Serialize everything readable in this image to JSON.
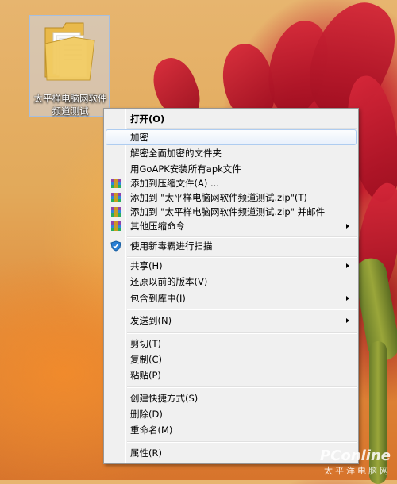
{
  "desktop": {
    "folder_label_line1": "太平样电脑网软件",
    "folder_label_line2": "频道测试"
  },
  "context_menu": {
    "items": [
      {
        "label": "打开(O)",
        "bold": true
      },
      {
        "label": "加密",
        "highlighted": true
      },
      {
        "label": "解密全面加密的文件夹"
      },
      {
        "label": "用GoAPK安装所有apk文件"
      },
      {
        "label": "添加到压缩文件(A) ...",
        "icon": "winrar-icon"
      },
      {
        "label": "添加到 \"太平样电脑网软件频道测试.zip\"(T)",
        "icon": "winrar-icon"
      },
      {
        "label": "添加到 \"太平样电脑网软件频道测试.zip\" 并邮件",
        "icon": "winrar-icon"
      },
      {
        "label": "其他压缩命令",
        "icon": "winrar-icon",
        "submenu": true
      },
      {
        "label": "使用新毒霸进行扫描",
        "icon": "duba-shield-icon"
      },
      {
        "label": "共享(H)",
        "submenu": true
      },
      {
        "label": "还原以前的版本(V)"
      },
      {
        "label": "包含到库中(I)",
        "submenu": true
      },
      {
        "label": "发送到(N)",
        "submenu": true
      },
      {
        "label": "剪切(T)"
      },
      {
        "label": "复制(C)"
      },
      {
        "label": "粘贴(P)"
      },
      {
        "label": "创建快捷方式(S)"
      },
      {
        "label": "删除(D)"
      },
      {
        "label": "重命名(M)"
      },
      {
        "label": "属性(R)"
      }
    ]
  },
  "watermark": {
    "line1": "PConline",
    "line2": "太平洋电脑网"
  },
  "colors": {
    "highlight_border": "#aeccf0",
    "menu_bg": "#f0f0f0"
  }
}
